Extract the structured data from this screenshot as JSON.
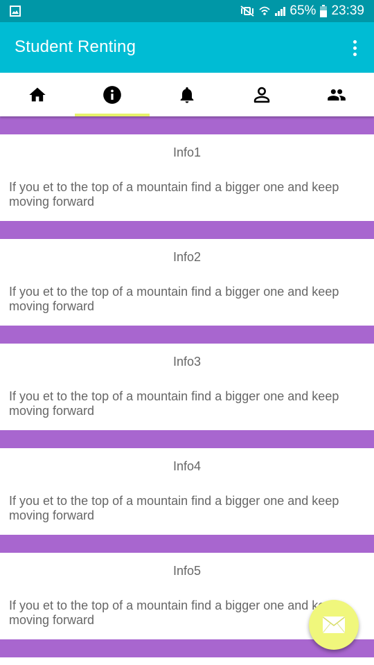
{
  "status_bar": {
    "battery": "65%",
    "time": "23:39",
    "icons": [
      "gallery-icon",
      "mute-vibrate-icon",
      "wifi-icon",
      "signal-icon",
      "battery-icon"
    ]
  },
  "app_bar": {
    "title": "Student Renting",
    "menu_icon": "more-vert-icon"
  },
  "tabs": [
    {
      "icon": "home-icon",
      "selected": false
    },
    {
      "icon": "info-icon",
      "selected": true
    },
    {
      "icon": "bell-icon",
      "selected": false
    },
    {
      "icon": "person-icon",
      "selected": false
    },
    {
      "icon": "people-icon",
      "selected": false
    }
  ],
  "cards": [
    {
      "title": "Info1",
      "body": "If you et to the top of a mountain find a bigger one and keep moving forward"
    },
    {
      "title": "Info2",
      "body": "If you et to the top of a mountain find a bigger one and keep moving forward"
    },
    {
      "title": "Info3",
      "body": "If you et to the top of a mountain find a bigger one and keep moving forward"
    },
    {
      "title": "Info4",
      "body": "If you et to the top of a mountain find a bigger one and keep moving forward"
    },
    {
      "title": "Info5",
      "body": "If you et to the top of a mountain find a bigger one and keep moving forward"
    }
  ],
  "fab": {
    "icon": "mail-icon"
  },
  "colors": {
    "status_bar": "#0097a7",
    "app_bar": "#00bcd4",
    "divider": "#a866cf",
    "tab_indicator": "#e6f26a",
    "fab": "#f0f77c",
    "text": "#666666"
  }
}
